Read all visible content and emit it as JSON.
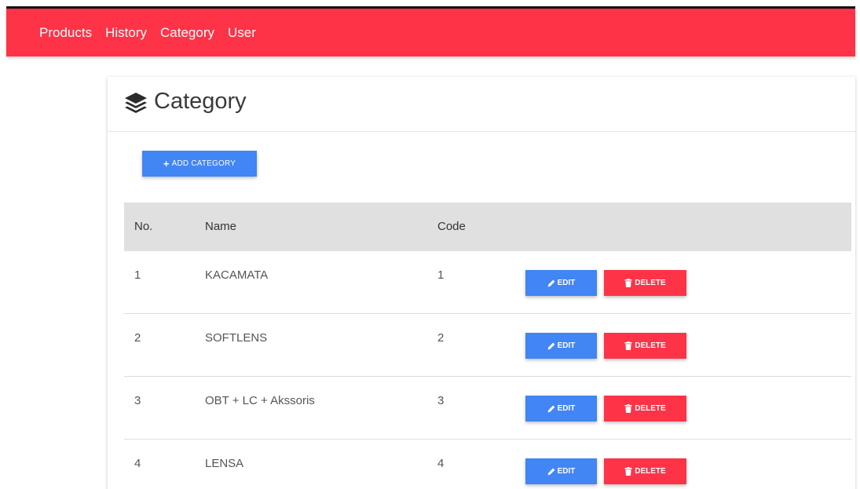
{
  "nav": {
    "items": [
      "Products",
      "History",
      "Category",
      "User"
    ]
  },
  "page": {
    "title": "Category",
    "title_icon": "layers-icon",
    "add_button_label": "ADD CATEGORY"
  },
  "table": {
    "headers": {
      "no": "No.",
      "name": "Name",
      "code": "Code"
    },
    "rows": [
      {
        "no": "1",
        "name": "KACAMATA",
        "code": "1"
      },
      {
        "no": "2",
        "name": "SOFTLENS",
        "code": "2"
      },
      {
        "no": "3",
        "name": "OBT + LC + Akssoris",
        "code": "3"
      },
      {
        "no": "4",
        "name": "LENSA",
        "code": "4"
      }
    ],
    "edit_label": "EDIT",
    "delete_label": "DELETE"
  },
  "colors": {
    "navbar": "#ff3347",
    "primary": "#4285f4",
    "danger": "#ff3347"
  }
}
